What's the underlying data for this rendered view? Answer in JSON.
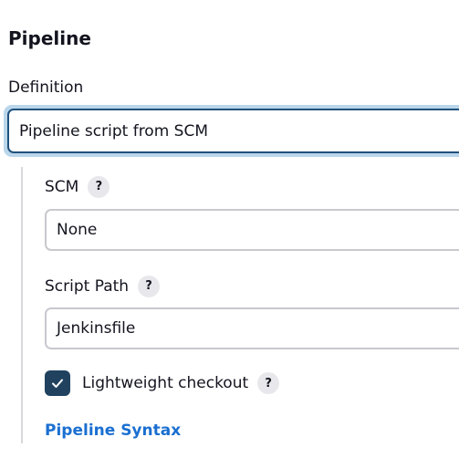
{
  "section": {
    "title": "Pipeline"
  },
  "definition": {
    "label": "Definition",
    "selected": "Pipeline script from SCM"
  },
  "scm": {
    "label": "SCM",
    "help": "?",
    "value": "None"
  },
  "script_path": {
    "label": "Script Path",
    "help": "?",
    "value": "Jenkinsfile"
  },
  "lightweight_checkout": {
    "label": "Lightweight checkout",
    "help": "?",
    "checked": true
  },
  "links": {
    "pipeline_syntax": "Pipeline Syntax"
  },
  "colors": {
    "accent": "#20527e",
    "focus_ring": "#bad6ea",
    "checkbox": "#20425f",
    "link": "#1a6fd1"
  },
  "icons": {
    "help": "question-mark-icon",
    "check": "checkmark-icon"
  }
}
